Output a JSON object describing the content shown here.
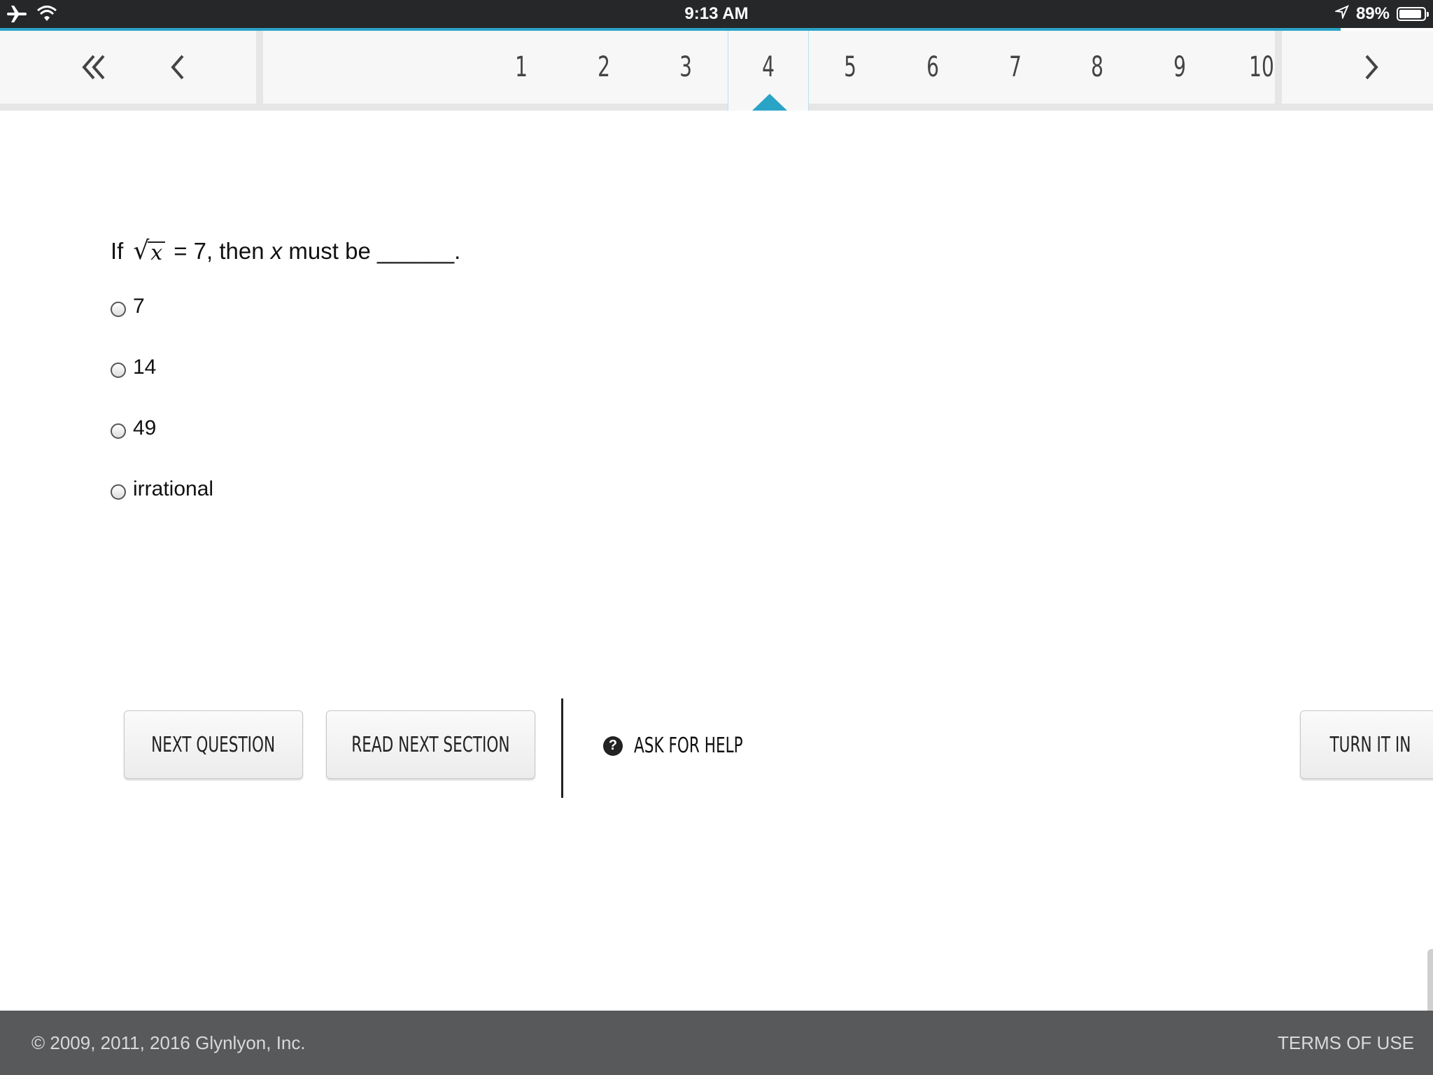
{
  "status_bar": {
    "time": "9:13 AM",
    "battery_text": "89%",
    "battery_level": 0.89,
    "left_icons": [
      "airplane-icon",
      "wifi-icon"
    ],
    "right_icons": [
      "location-arrow-icon",
      "battery-icon"
    ]
  },
  "question_nav": {
    "numbers": [
      "1",
      "2",
      "3",
      "4",
      "5",
      "6",
      "7",
      "8",
      "9",
      "10"
    ],
    "active": "4",
    "active_color": "#2aa4c6"
  },
  "question": {
    "prefix": "If",
    "radicand": "x",
    "after_root": "= 7, then",
    "variable": "x",
    "suffix": "must be ______."
  },
  "options": [
    "7",
    "14",
    "49",
    "irrational"
  ],
  "actions": {
    "next_question": "NEXT QUESTION",
    "read_next_section": "READ NEXT SECTION",
    "ask_for_help": "ASK FOR HELP",
    "turn_it_in": "TURN IT IN"
  },
  "footer": {
    "copyright": "© 2009, 2011, 2016 Glynlyon, Inc.",
    "terms": "TERMS OF USE"
  }
}
